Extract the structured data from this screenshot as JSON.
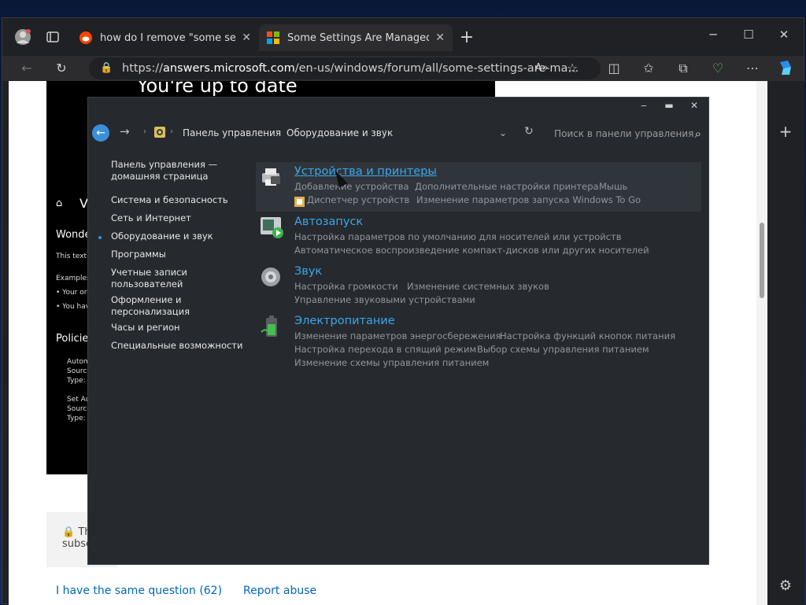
{
  "browser": {
    "tabs": [
      {
        "title": "how do I remove \"some settings are managed by your organization\"",
        "active": false
      },
      {
        "title": "Some Settings Are Managed By Your Organization",
        "active": true
      }
    ],
    "new_tab": "+",
    "window_controls": {
      "minimize": "─",
      "maximize": "☐",
      "close": "✕"
    },
    "address": {
      "prefix": "https://",
      "host": "answers.microsoft.com",
      "path": "/en-us/windows/forum/all/some-settings-are-ma..."
    },
    "toolbar_icons": [
      "back-icon",
      "refresh-icon",
      "lock-icon",
      "read-aloud-icon",
      "favorite-icon",
      "split-screen-icon",
      "favorites-icon",
      "collections-icon",
      "health-icon",
      "more-icon",
      "copilot-icon"
    ],
    "sidepanel": {
      "add": "+",
      "settings": "⚙"
    }
  },
  "page": {
    "dark_heading": "You're up to date",
    "sidebar_letters": [
      "V",
      "Wonde",
      "This text r",
      "Examples",
      "• Your org",
      "• You hav",
      "Policies",
      "Autom",
      "Source",
      "Type: (",
      "Set Au",
      "Source",
      "Type: ("
    ],
    "infobox_text": [
      "Th",
      "subsc"
    ],
    "link_same_question": "I have the same question (62)",
    "link_report": "Report abuse"
  },
  "control_panel": {
    "breadcrumb": [
      "Панель управления",
      "Оборудование и звук"
    ],
    "search_placeholder": "Поиск в панели управления",
    "left_nav": [
      "Панель управления — домашняя страница",
      "Система и безопасность",
      "Сеть и Интернет",
      "Оборудование и звук",
      "Программы",
      "Учетные записи пользователей",
      "Оформление и персонализация",
      "Часы и регион",
      "Специальные возможности"
    ],
    "categories": [
      {
        "title": "Устройства и принтеры",
        "icon": "printer-icon",
        "links": [
          "Добавление устройства",
          "Дополнительные настройки принтера",
          "Мышь",
          "Диспетчер устройств",
          "Изменение параметров запуска Windows To Go"
        ]
      },
      {
        "title": "Автозапуск",
        "icon": "autoplay-icon",
        "links": [
          "Настройка параметров по умолчанию для носителей или устройств",
          "Автоматическое воспроизведение компакт-дисков или других носителей"
        ]
      },
      {
        "title": "Звук",
        "icon": "speaker-icon",
        "links": [
          "Настройка громкости",
          "Изменение системных звуков",
          "Управление звуковыми устройствами"
        ]
      },
      {
        "title": "Электропитание",
        "icon": "battery-icon",
        "links": [
          "Изменение параметров энергосбережения",
          "Настройка функций кнопок питания",
          "Настройка перехода в спящий режим",
          "Выбор схемы управления питанием",
          "Изменение схемы управления питанием"
        ]
      }
    ],
    "accent_color": "#3ba7e8"
  }
}
